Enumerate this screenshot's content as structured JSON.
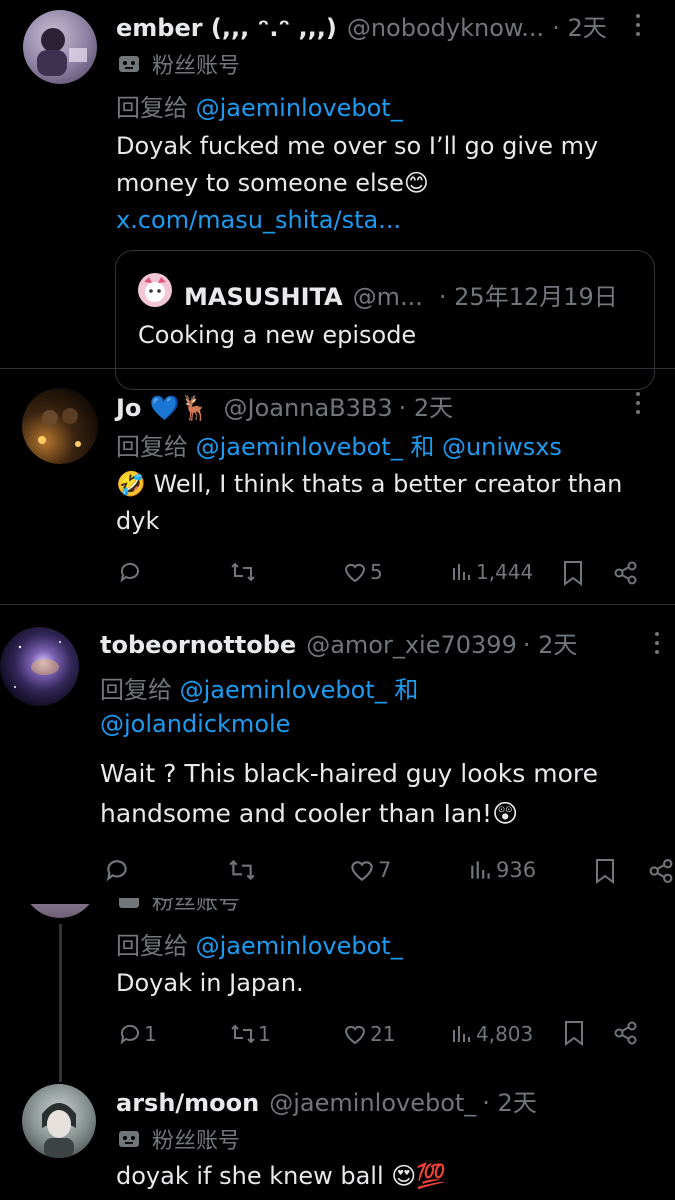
{
  "tweets": [
    {
      "name": "ember (,,, ᵔ.ᵔ ,,,)",
      "handle": "@nobodyknow...",
      "time": "· 2天",
      "fan_label": "粉丝账号",
      "reply_prefix": "回复给",
      "reply_to": "@jaeminlovebot_",
      "text_line1": "Doyak fucked me over so I’ll go give my",
      "text_line2": "money to someone else😊",
      "link": "x.com/masu_shita/sta...",
      "quote": {
        "name": "MASUSHITA",
        "handle": "@m...",
        "date": "· 25年12月19日",
        "text": "Cooking a new episode"
      }
    },
    {
      "name": "Jo 💙🦌",
      "handle": "@JoannaB3B3",
      "time": "· 2天",
      "reply_prefix": "回复给",
      "reply_to": "@jaeminlovebot_",
      "conj": "和",
      "reply_to2": "@uniwsxs",
      "text_line1": "🤣 Well, I think thats a better creator than",
      "text_line2": "dyk",
      "likes": "5",
      "views": "1,444"
    },
    {
      "name": "tobeornottobe",
      "handle": "@amor_xie70399",
      "time": "· 2天",
      "reply_prefix": "回复给",
      "reply_to": "@jaeminlovebot_",
      "conj": "和",
      "reply_to2": "@jolandickmole",
      "text_line1": "Wait ? This black-haired guy looks more",
      "text_line2": "handsome and cooler than Ian!😲",
      "likes": "7",
      "views": "936"
    },
    {
      "fan_label": "粉丝账号",
      "reply_prefix": "回复给",
      "reply_to": "@jaeminlovebot_",
      "text": "Doyak in Japan.",
      "replies": "1",
      "retweets": "1",
      "likes": "21",
      "views": "4,803"
    },
    {
      "name": "arsh/moon",
      "handle": "@jaeminlovebot_",
      "time": "· 2天",
      "fan_label": "粉丝账号",
      "text": "doyak if she knew ball 😍💯"
    }
  ],
  "colors": {
    "accent": "#1d9bf0",
    "muted": "#71767b",
    "text": "#e7e9ea",
    "divider": "#2f3336"
  },
  "icons": [
    "reply-icon",
    "retweet-icon",
    "like-icon",
    "views-icon",
    "bookmark-icon",
    "share-icon",
    "more-icon",
    "bot-icon"
  ]
}
